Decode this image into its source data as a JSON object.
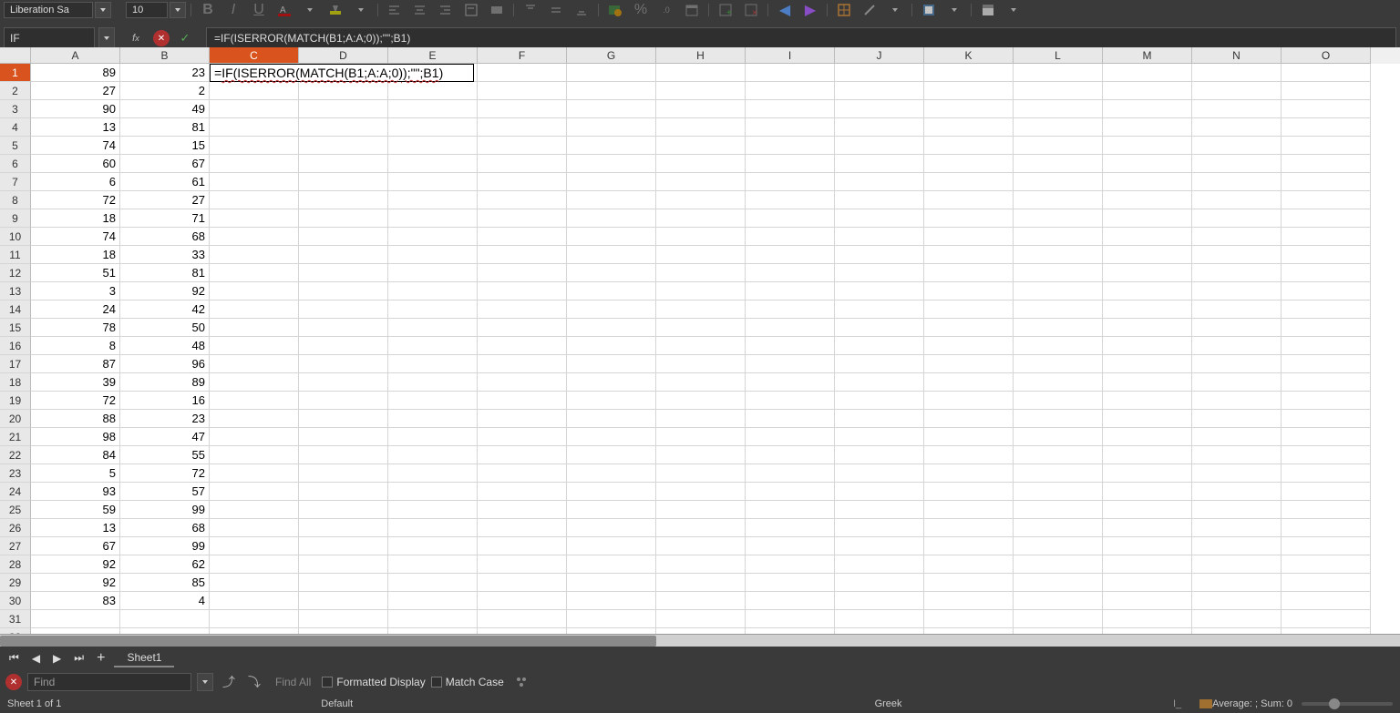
{
  "toolbar": {
    "font_name": "Liberation Sa",
    "font_size": "10"
  },
  "formula_bar": {
    "name_box": "IF",
    "formula": "=IF(ISERROR(MATCH(B1;A:A;0));\"\";B1)"
  },
  "columns": [
    "A",
    "B",
    "C",
    "D",
    "E",
    "F",
    "G",
    "H",
    "I",
    "J",
    "K",
    "L",
    "M",
    "N",
    "O"
  ],
  "active_column_index": 2,
  "active_row_index": 0,
  "row_count": 32,
  "cell_edit": {
    "text_pre": "=",
    "text_wavy": "IF(ISERROR(MATCH(B1;A:A;0));\"\";B1",
    "text_post": ")"
  },
  "data": {
    "A": [
      89,
      27,
      90,
      13,
      74,
      60,
      6,
      72,
      18,
      74,
      18,
      51,
      3,
      24,
      78,
      8,
      87,
      39,
      72,
      88,
      98,
      84,
      5,
      93,
      59,
      13,
      67,
      92,
      92,
      83
    ],
    "B": [
      23,
      2,
      49,
      81,
      15,
      67,
      61,
      27,
      71,
      68,
      33,
      81,
      92,
      42,
      50,
      48,
      96,
      89,
      16,
      23,
      47,
      55,
      72,
      57,
      99,
      68,
      99,
      62,
      85,
      4
    ]
  },
  "sheet_tabs": {
    "active": "Sheet1"
  },
  "find_bar": {
    "placeholder": "Find",
    "find_all": "Find All",
    "formatted": "Formatted Display",
    "match_case": "Match Case"
  },
  "status": {
    "sheet_info": "Sheet 1 of 1",
    "style": "Default",
    "lang": "Greek",
    "stats": "Average: ; Sum: 0"
  }
}
